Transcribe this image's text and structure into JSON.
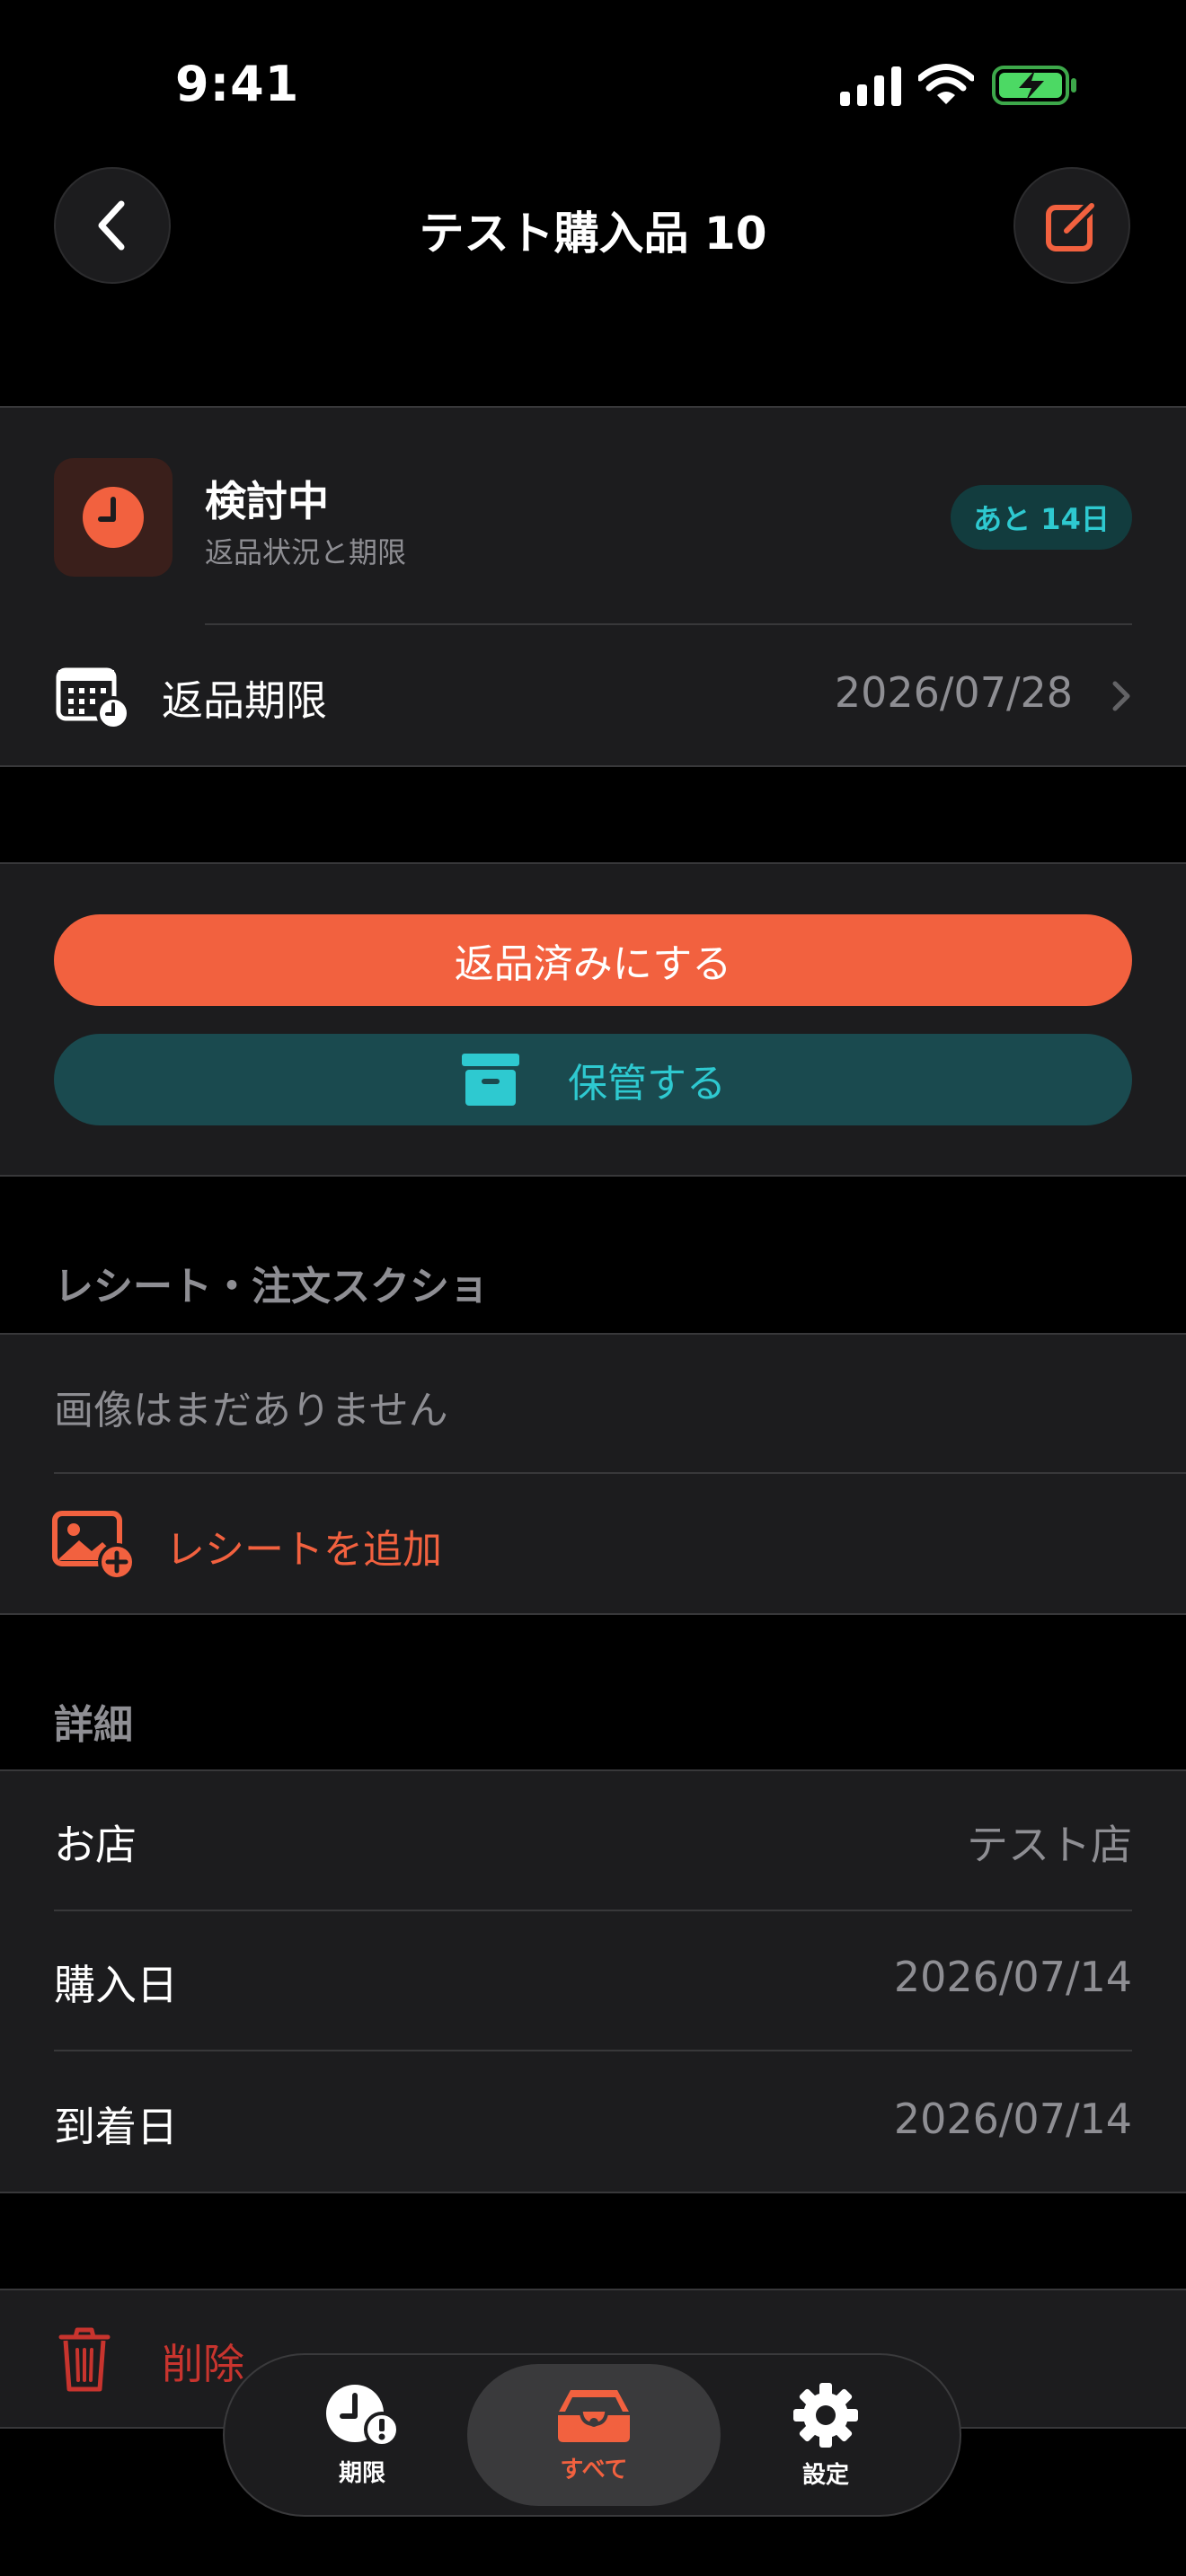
{
  "status_bar": {
    "time": "9:41"
  },
  "nav": {
    "title": "テスト購入品 10"
  },
  "status_card": {
    "title": "検討中",
    "subtitle": "返品状況と期限",
    "badge": "あと 14日",
    "deadline_label": "返品期限",
    "deadline_value": "2026/07/28"
  },
  "actions": {
    "returned_label": "返品済みにする",
    "archive_label": "保管する"
  },
  "receipts": {
    "header": "レシート・注文スクショ",
    "empty_text": "画像はまだありません",
    "add_label": "レシートを追加"
  },
  "details": {
    "header": "詳細",
    "rows": [
      {
        "label": "お店",
        "value": "テスト店"
      },
      {
        "label": "購入日",
        "value": "2026/07/14"
      },
      {
        "label": "到着日",
        "value": "2026/07/14"
      }
    ]
  },
  "delete": {
    "label": "削除"
  },
  "tabbar": {
    "tabs": [
      {
        "label": "期限"
      },
      {
        "label": "すべて"
      },
      {
        "label": "設定"
      }
    ]
  },
  "colors": {
    "accent": "#f2613f",
    "teal": "#2ec9d0",
    "teal_bg": "#1a4a4f",
    "danger": "#c8342e"
  }
}
